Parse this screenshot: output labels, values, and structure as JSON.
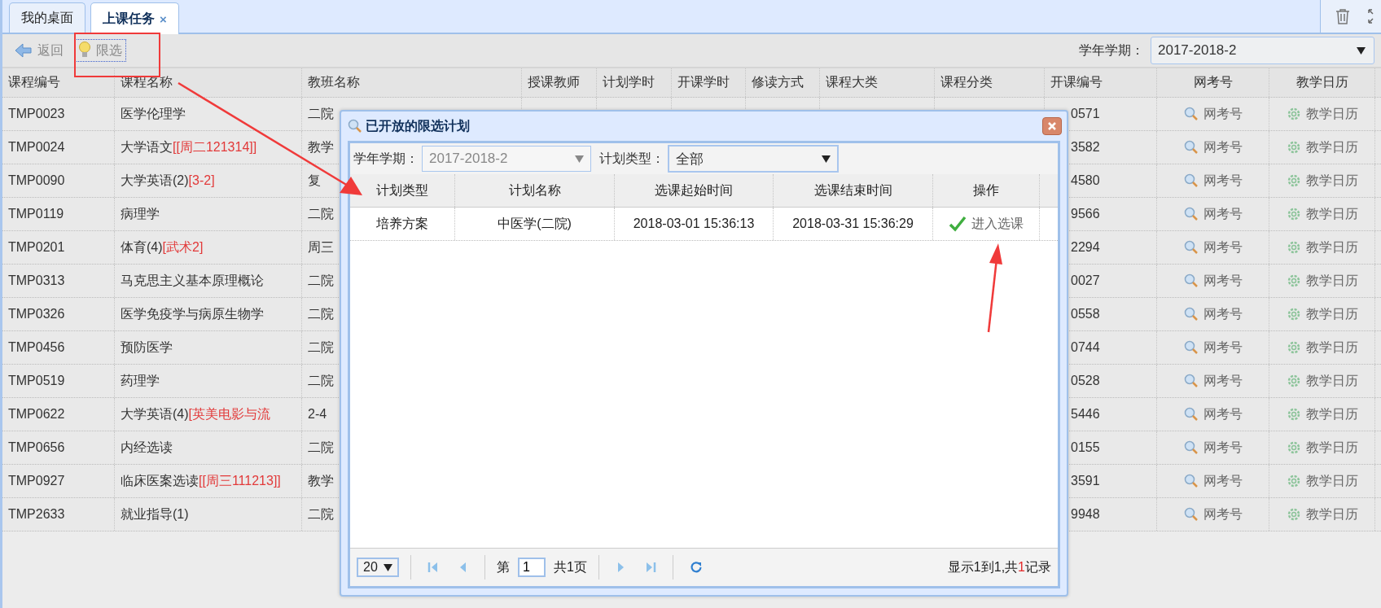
{
  "tabs": [
    {
      "label": "我的桌面",
      "selected": false,
      "closable": false
    },
    {
      "label": "上课任务",
      "selected": true,
      "closable": true
    }
  ],
  "tab_close": "×",
  "toolbar": {
    "buttons": [
      {
        "label": "返回",
        "kind": "back"
      },
      {
        "label": "限选",
        "kind": "filter"
      }
    ],
    "term": {
      "label": "学年学期：",
      "value": "2017-2018-2"
    }
  },
  "table": {
    "columns": [
      "课程编号",
      "课程名称",
      "教班名称",
      "授课教师",
      "计划学时",
      "开课学时",
      "修读方式",
      "课程大类",
      "课程分类",
      "开课编号",
      "网考号",
      "教学日历"
    ],
    "rows": [
      {
        "code": "TMP0023",
        "name": "医学伦理学",
        "class_name": "二院",
        "open_no": "0571",
        "exam": "网考号",
        "calendar": "教学日历"
      },
      {
        "code": "TMP0024",
        "name": "大学语文",
        "tag": "[[周二121314]]",
        "class_name": "教学",
        "open_no": "3582",
        "exam": "网考号",
        "calendar": "教学日历"
      },
      {
        "code": "TMP0090",
        "name": "大学英语(2)",
        "tag": "[3-2]",
        "class_name": "复",
        "open_no": "4580",
        "exam": "网考号",
        "calendar": "教学日历"
      },
      {
        "code": "TMP0119",
        "name": "病理学",
        "class_name": "二院",
        "open_no": "9566",
        "exam": "网考号",
        "calendar": "教学日历"
      },
      {
        "code": "TMP0201",
        "name": "体育(4)",
        "tag": "[武术2]",
        "class_name": "周三",
        "open_no": "2294",
        "exam": "网考号",
        "calendar": "教学日历"
      },
      {
        "code": "TMP0313",
        "name": "马克思主义基本原理概论",
        "class_name": "二院",
        "open_no": "0027",
        "exam": "网考号",
        "calendar": "教学日历"
      },
      {
        "code": "TMP0326",
        "name": "医学免疫学与病原生物学",
        "class_name": "二院",
        "open_no": "0558",
        "exam": "网考号",
        "calendar": "教学日历"
      },
      {
        "code": "TMP0456",
        "name": "预防医学",
        "class_name": "二院",
        "open_no": "0744",
        "exam": "网考号",
        "calendar": "教学日历"
      },
      {
        "code": "TMP0519",
        "name": "药理学",
        "class_name": "二院",
        "open_no": "0528",
        "exam": "网考号",
        "calendar": "教学日历"
      },
      {
        "code": "TMP0622",
        "name": "大学英语(4)",
        "tag": "[英美电影与流",
        "class_name": "2-4",
        "open_no": "5446",
        "exam": "网考号",
        "calendar": "教学日历"
      },
      {
        "code": "TMP0656",
        "name": "内经选读",
        "class_name": "二院",
        "open_no": "0155",
        "exam": "网考号",
        "calendar": "教学日历"
      },
      {
        "code": "TMP0927",
        "name": "临床医案选读",
        "tag": "[[周三111213]]",
        "class_name": "教学",
        "open_no": "3591",
        "exam": "网考号",
        "calendar": "教学日历"
      },
      {
        "code": "TMP2633",
        "name": "就业指导(1)",
        "class_name": "二院",
        "open_no": "9948",
        "exam": "网考号",
        "calendar": "教学日历"
      }
    ]
  },
  "dialog": {
    "title": "已开放的限选计划",
    "filters": [
      {
        "label": "学年学期：",
        "value": "2017-2018-2",
        "disabled": true
      },
      {
        "label": "计划类型：",
        "value": "全部",
        "disabled": false
      }
    ],
    "columns": [
      "计划类型",
      "计划名称",
      "选课起始时间",
      "选课结束时间",
      "操作"
    ],
    "rows": [
      {
        "plan_type": "培养方案",
        "plan_name": "中医学(二院)",
        "start": "2018-03-01 15:36:13",
        "end": "2018-03-31 15:36:29",
        "action": "进入选课"
      }
    ],
    "pager": {
      "page_size": "20",
      "page_prefix": "第",
      "page": "1",
      "page_suffix": "共1页",
      "summary_before": "显示1到1,共",
      "summary_count": "1",
      "summary_after": "记录"
    }
  }
}
